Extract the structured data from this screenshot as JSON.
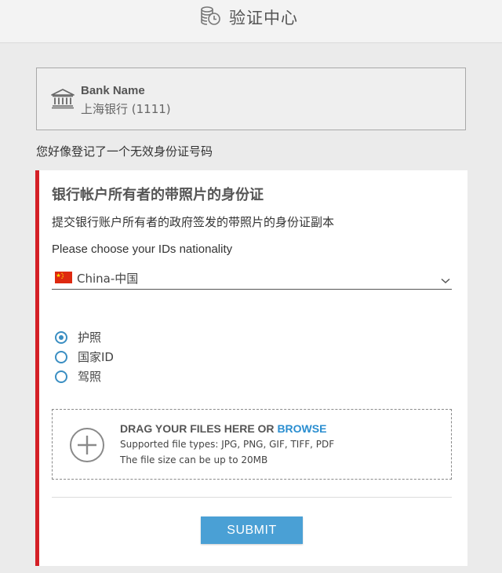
{
  "header": {
    "title": "验证中心",
    "icon": "coins-clock-icon"
  },
  "bank": {
    "icon": "bank-building-icon",
    "label": "Bank Name",
    "value": "上海银行 (1111)"
  },
  "warning": "您好像登记了一个无效身份证号码",
  "panel": {
    "title": "银行帐户所有者的带照片的身份证",
    "subtitle": "提交银行账户所有者的政府签发的带照片的身份证副本",
    "nationality_label": "Please choose your IDs nationality",
    "nationality": {
      "flag": "china-flag-icon",
      "selected": "China-中国"
    },
    "id_types": [
      {
        "label": "护照",
        "checked": true
      },
      {
        "label": "国家ID",
        "checked": false
      },
      {
        "label": "驾照",
        "checked": false
      }
    ],
    "upload": {
      "title": "DRAG YOUR FILES HERE OR ",
      "browse": "BROWSE",
      "types": "Supported file types: JPG, PNG, GIF, TIFF, PDF",
      "size": "The file size can be up to 20MB"
    },
    "submit_label": "SUBMIT"
  },
  "colors": {
    "accent_red": "#d41f26",
    "primary_blue": "#4aa0d5",
    "link_blue": "#2a8ed0"
  }
}
